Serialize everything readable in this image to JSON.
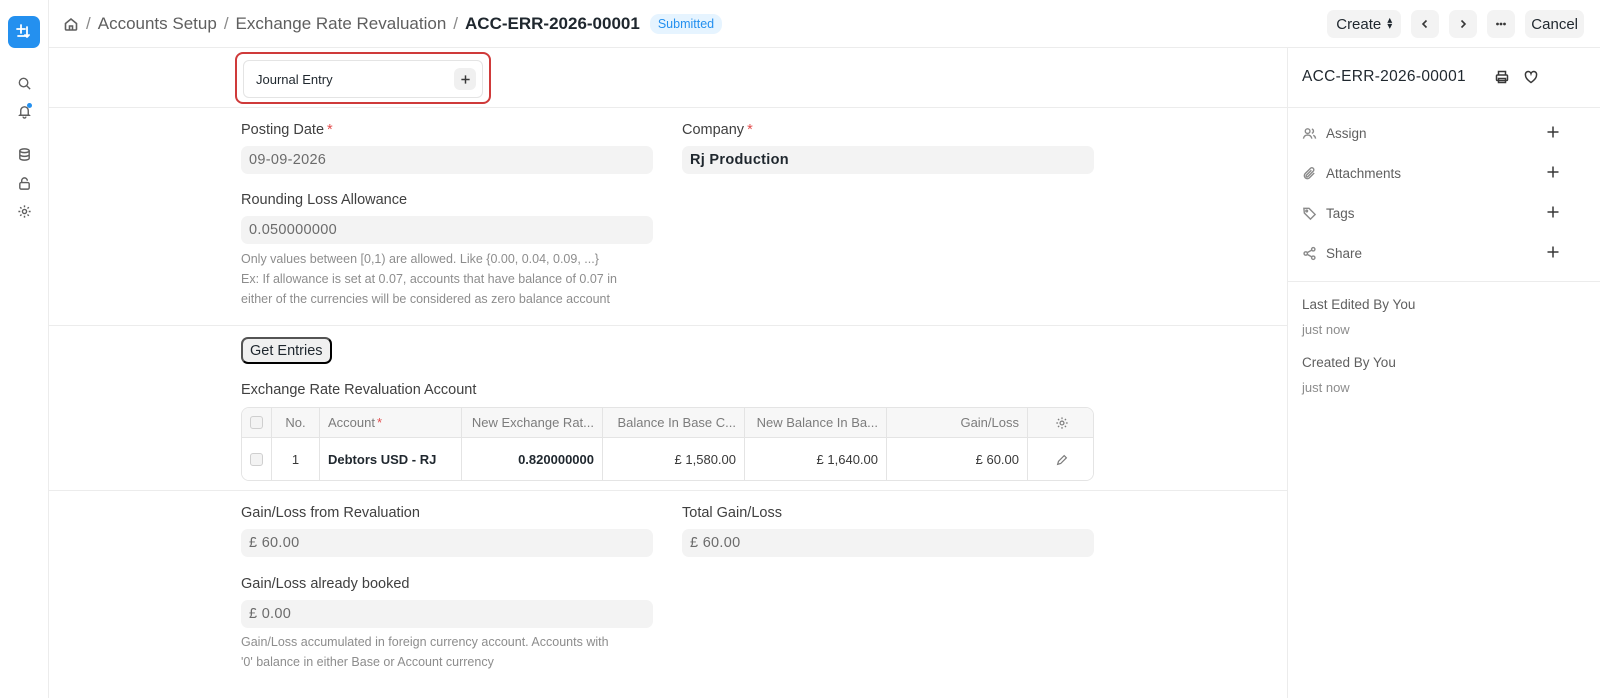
{
  "header": {
    "breadcrumbs": [
      "Accounts Setup",
      "Exchange Rate Revaluation"
    ],
    "current": "ACC-ERR-2026-00001",
    "status": "Submitted",
    "create_label": "Create",
    "cancel_label": "Cancel"
  },
  "connections": {
    "label": "Journal Entry"
  },
  "form": {
    "posting_date_label": "Posting Date",
    "posting_date": "09-09-2026",
    "company_label": "Company",
    "company": "Rj Production",
    "rounding_label": "Rounding Loss Allowance",
    "rounding": "0.050000000",
    "rounding_help": [
      "Only values between [0,1) are allowed. Like {0.00, 0.04, 0.09, ...}",
      "Ex: If allowance is set at 0.07, accounts that have balance of 0.07 in",
      "either of the currencies will be considered as zero balance account"
    ],
    "get_entries": "Get Entries",
    "table_title": "Exchange Rate Revaluation Account",
    "gain_loss_reval_label": "Gain/Loss from Revaluation",
    "gain_loss_reval": "£ 60.00",
    "total_gain_loss_label": "Total Gain/Loss",
    "total_gain_loss": "£ 60.00",
    "already_booked_label": "Gain/Loss already booked",
    "already_booked": "£ 0.00",
    "already_booked_help": [
      "Gain/Loss accumulated in foreign currency account. Accounts with",
      "'0' balance in either Base or Account currency"
    ]
  },
  "table": {
    "columns": [
      "No.",
      "Account",
      "New Exchange Rat...",
      "Balance In Base C...",
      "New Balance In Ba...",
      "Gain/Loss"
    ],
    "rows": [
      {
        "no": "1",
        "account": "Debtors USD - RJ",
        "new_rate": "0.820000000",
        "balance_base": "£ 1,580.00",
        "new_balance_base": "£ 1,640.00",
        "gain_loss": "£ 60.00"
      }
    ]
  },
  "sidebar": {
    "title": "ACC-ERR-2026-00001",
    "items": [
      "Assign",
      "Attachments",
      "Tags",
      "Share"
    ],
    "last_edited": "Last Edited By You",
    "last_edited_time": "just now",
    "created": "Created By You",
    "created_time": "just now"
  },
  "colors": {
    "accent": "#2490ef",
    "highlight_border": "#cf3a3a",
    "required": "#e24c4c"
  }
}
